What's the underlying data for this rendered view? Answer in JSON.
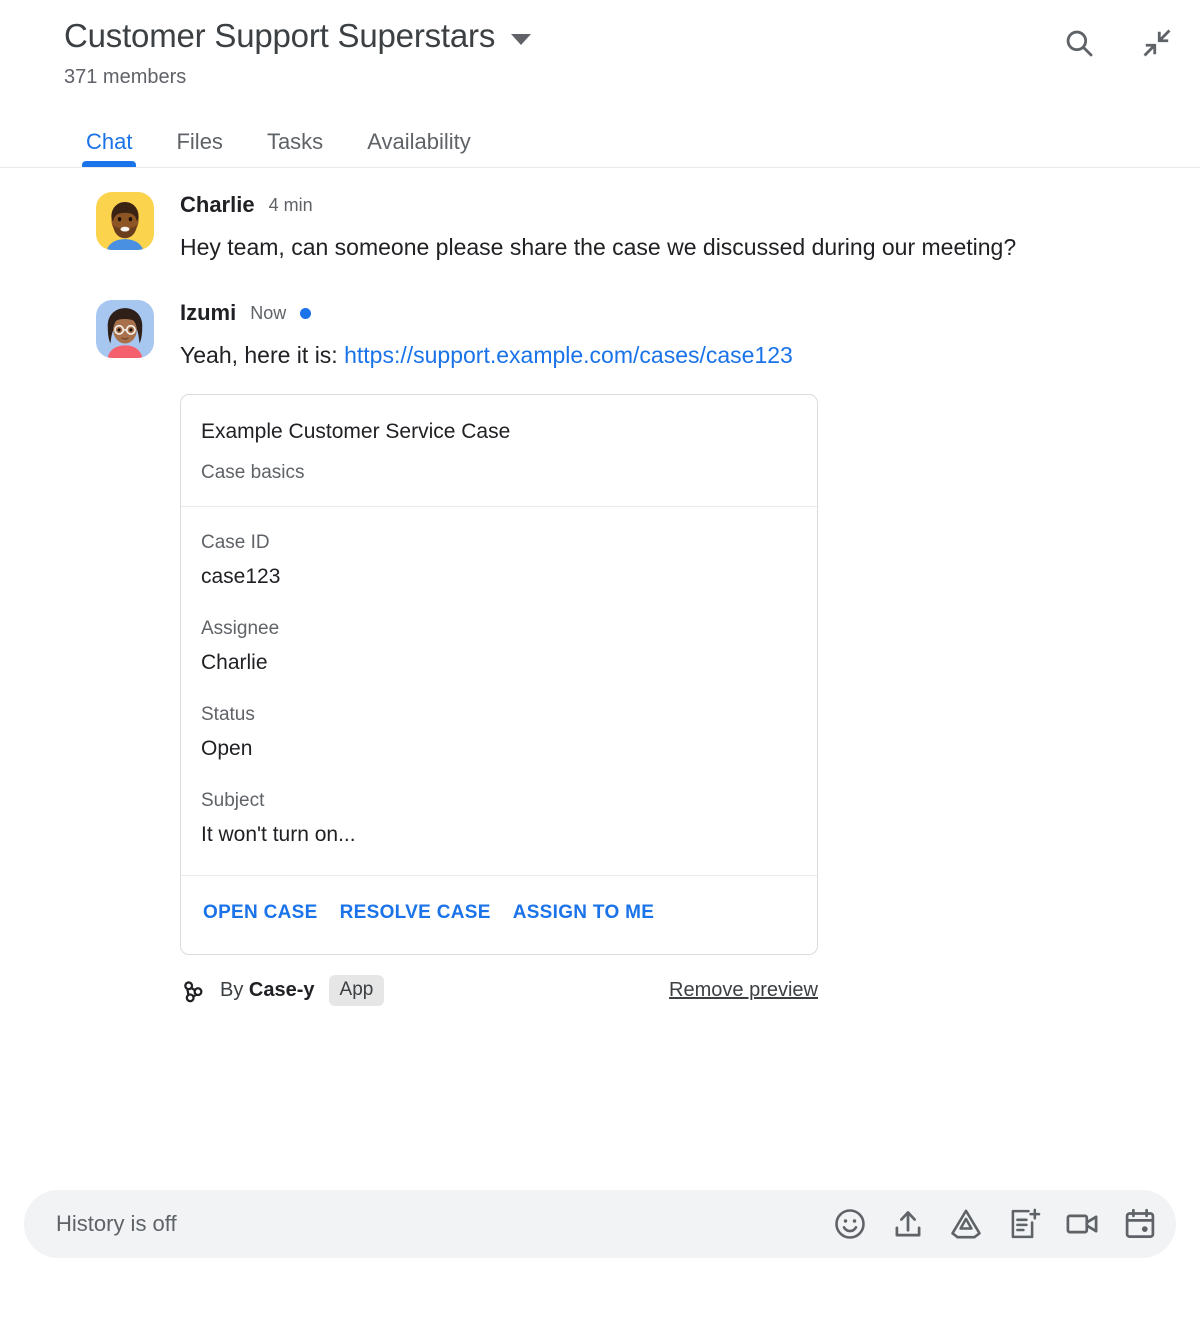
{
  "header": {
    "title": "Customer Support Superstars",
    "members": "371 members",
    "dropdown_icon": "chevron-down-icon",
    "search_icon": "search-icon",
    "collapse_icon": "collapse-icon"
  },
  "tabs": [
    {
      "label": "Chat",
      "active": true
    },
    {
      "label": "Files",
      "active": false
    },
    {
      "label": "Tasks",
      "active": false
    },
    {
      "label": "Availability",
      "active": false
    }
  ],
  "messages": [
    {
      "author": "Charlie",
      "time": "4 min",
      "unread": false,
      "text": "Hey team, can someone please share the case we discussed during our meeting?"
    },
    {
      "author": "Izumi",
      "time": "Now",
      "unread": true,
      "text_prefix": "Yeah, here it is: ",
      "link": "https://support.example.com/cases/case123"
    }
  ],
  "card": {
    "title": "Example Customer Service Case",
    "subtitle": "Case basics",
    "fields": [
      {
        "label": "Case ID",
        "value": "case123"
      },
      {
        "label": "Assignee",
        "value": "Charlie"
      },
      {
        "label": "Status",
        "value": "Open"
      },
      {
        "label": "Subject",
        "value": "It won't turn on..."
      }
    ],
    "actions": [
      {
        "label": "OPEN CASE"
      },
      {
        "label": "RESOLVE CASE"
      },
      {
        "label": "ASSIGN TO ME"
      }
    ]
  },
  "attribution": {
    "icon": "webhook-icon",
    "by_text": "By ",
    "app_name": "Case-y",
    "badge": "App",
    "remove_label": "Remove preview"
  },
  "composer": {
    "placeholder": "History is off",
    "icons": [
      "emoji-icon",
      "upload-icon",
      "google-drive-icon",
      "add-document-icon",
      "video-call-icon",
      "calendar-icon"
    ],
    "send_icon": "send-icon"
  },
  "colors": {
    "accent": "#1a73e8",
    "link": "#1a73e8",
    "text_primary": "#202124",
    "text_secondary": "#5f6368",
    "border": "#dadce0",
    "composer_bg": "#f1f3f4",
    "badge_bg": "#e6e6e6"
  }
}
